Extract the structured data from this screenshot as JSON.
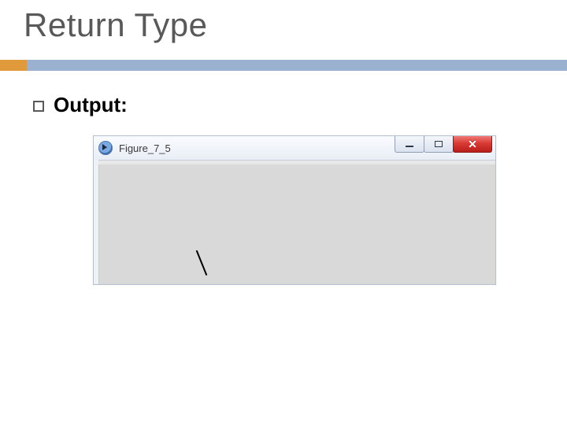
{
  "slide": {
    "title": "Return Type",
    "bullet": "Output:"
  },
  "window": {
    "title": "Figure_7_5",
    "controls": {
      "minimize": "min",
      "maximize": "max",
      "close": "✕"
    },
    "content_glyph": "\\"
  }
}
